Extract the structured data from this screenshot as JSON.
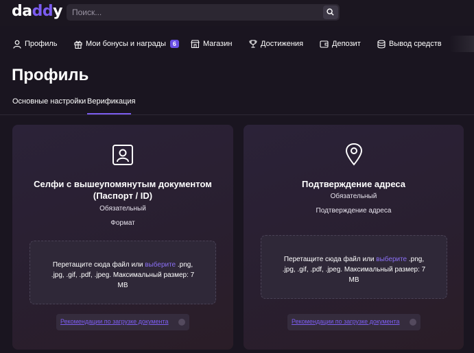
{
  "header": {
    "logo": {
      "part1": "da",
      "part2": "dd",
      "part3": "y"
    },
    "search": {
      "placeholder": "Поиск..."
    }
  },
  "nav": {
    "items": [
      {
        "label": "Профиль",
        "icon": "user-icon"
      },
      {
        "label": "Мои бонусы и награды",
        "icon": "gift-icon",
        "badge": "6"
      },
      {
        "label": "Магазин",
        "icon": "shop-icon"
      },
      {
        "label": "Достижения",
        "icon": "trophy-icon"
      },
      {
        "label": "Депозит",
        "icon": "wallet-icon"
      },
      {
        "label": "Вывод средств",
        "icon": "coins-icon"
      }
    ]
  },
  "page": {
    "title": "Профиль"
  },
  "tabs": [
    {
      "label": "Основные настройки",
      "active": false
    },
    {
      "label": "Верификация",
      "active": true
    }
  ],
  "cards": [
    {
      "icon": "id-card-icon",
      "title_line1": "Селфи с вышеупомянутым документом",
      "title_line2": "(Паспорт / ID)",
      "required": "Обязательный",
      "subtitle": "Формат",
      "drop": {
        "prefix": "Перетащите сюда файл или",
        "link": "выберите",
        "suffix": ".png, .jpg, .gif, .pdf, .jpeg. Максимальный размер: 7 MB"
      },
      "recommendations": "Рекомендации по загрузке документа"
    },
    {
      "icon": "location-pin-icon",
      "title_line1": "Подтверждение адреса",
      "required": "Обязательный",
      "subtitle": "Подтверждение адреса",
      "drop": {
        "prefix": "Перетащите сюда файл или",
        "link": "выберите",
        "suffix": ".png, .jpg, .gif, .pdf, .jpeg. Максимальный размер: 7 MB"
      },
      "recommendations": "Рекомендации по загрузке документа"
    }
  ],
  "colors": {
    "accent": "#7b5cf0",
    "background": "#1a1520",
    "card": "#2b2238"
  }
}
